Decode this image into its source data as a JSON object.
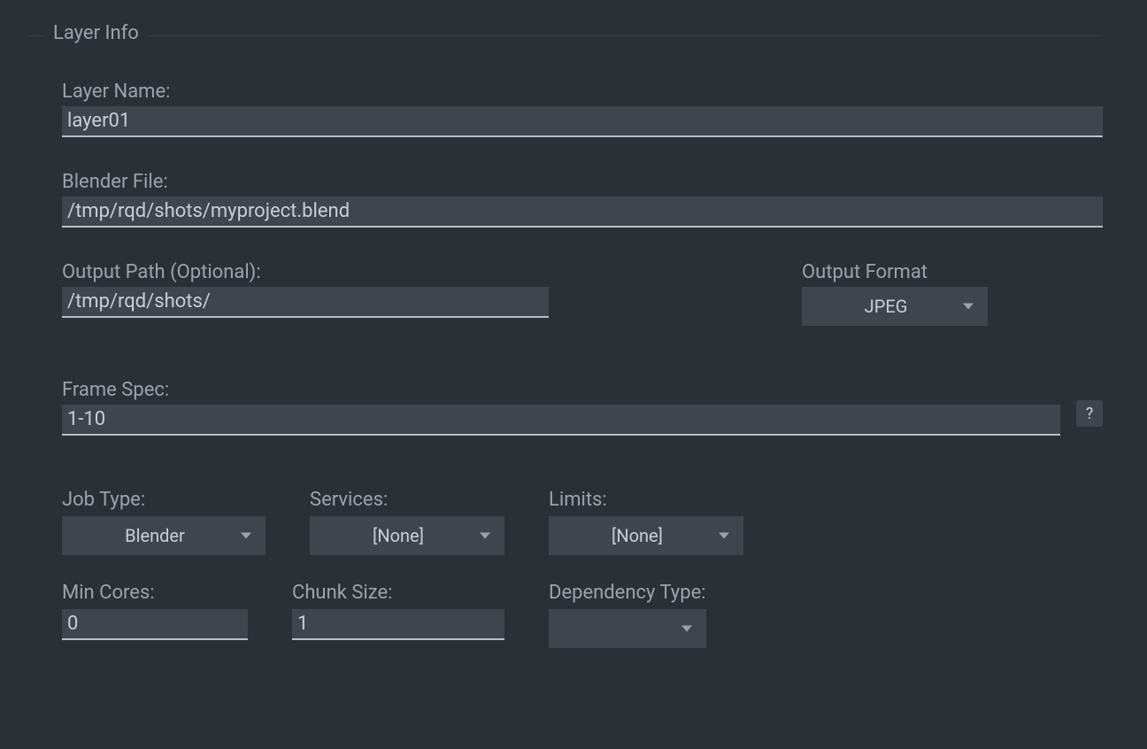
{
  "groupTitle": "Layer Info",
  "layerName": {
    "label": "Layer Name:",
    "value": "layer01"
  },
  "blenderFile": {
    "label": "Blender File:",
    "value": "/tmp/rqd/shots/myproject.blend"
  },
  "outputPath": {
    "label": "Output Path (Optional):",
    "value": "/tmp/rqd/shots/"
  },
  "outputFormat": {
    "label": "Output Format",
    "value": "JPEG"
  },
  "frameSpec": {
    "label": "Frame Spec:",
    "value": "1-10"
  },
  "helpLabel": "?",
  "jobType": {
    "label": "Job Type:",
    "value": "Blender"
  },
  "services": {
    "label": "Services:",
    "value": "[None]"
  },
  "limits": {
    "label": "Limits:",
    "value": "[None]"
  },
  "minCores": {
    "label": "Min Cores:",
    "value": "0"
  },
  "chunkSize": {
    "label": "Chunk Size:",
    "value": "1"
  },
  "dependencyType": {
    "label": "Dependency Type:",
    "value": ""
  }
}
